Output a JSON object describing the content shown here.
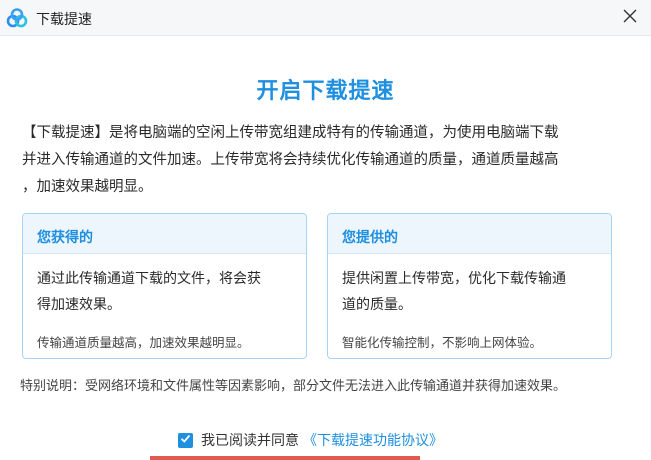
{
  "window": {
    "title": "下载提速",
    "logo_icon": "baidu-netdisk-cloud-icon",
    "close_icon": "close-icon"
  },
  "main": {
    "heading": "开启下载提速",
    "intro_lines": [
      "【下载提速】是将电脑端的空闲上传带宽组建成特有的传输通道，为使用电脑端下载",
      "并进入传输通道的文件加速。上传带宽将会持续优化传输通道的质量，通道质量越高",
      "，加速效果越明显。"
    ]
  },
  "cards": {
    "gain": {
      "title": "您获得的",
      "body_lines": [
        "通过此传输通道下载的文件，将会获",
        "得加速效果。"
      ],
      "note": "传输通道质量越高，加速效果越明显。"
    },
    "provide": {
      "title": "您提供的",
      "body_lines": [
        "提供闲置上传带宽，优化下载传输通",
        "道的质量。"
      ],
      "note": "智能化传输控制，不影响上网体验。"
    }
  },
  "notice": "特别说明：受网络环境和文件属性等因素影响，部分文件无法进入此传输通道并获得加速效果。",
  "agreement": {
    "checked": true,
    "label": "我已阅读并同意",
    "link": "《下载提速功能协议》"
  },
  "colors": {
    "accent": "#1f8fe0",
    "card_border": "#a9d3f2",
    "card_header_bg": "#eef6fd"
  }
}
